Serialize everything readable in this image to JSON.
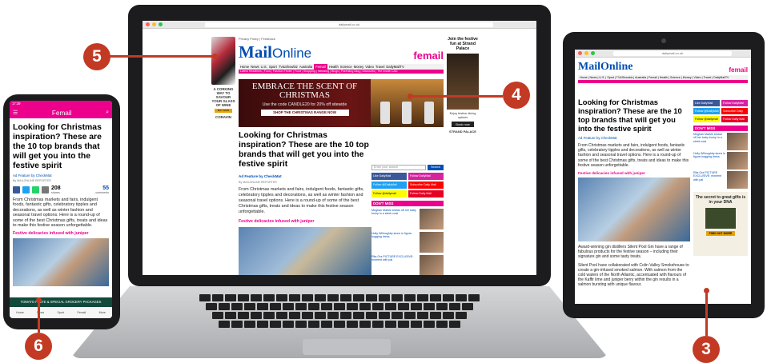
{
  "laptop": {
    "url": "dailymail.co.uk",
    "topline": "Privacy Policy | Feedback",
    "logo_mail": "Mail",
    "logo_online": "Online",
    "femail": "femail",
    "nav": [
      "Home",
      "News",
      "U.S.",
      "Sport",
      "TV&Showbiz",
      "Australia",
      "Femail",
      "Health",
      "Science",
      "Money",
      "Video",
      "Travel",
      "DailyMailTV"
    ],
    "subnav": "Latest Headlines | Food | Fashion Finder | Food | Shopping | Wedding | Blogs | Parenting Blog | Discounts | The Inside CAD",
    "left_ad": {
      "text": "A CORKING WAY TO SAVOUR YOUR GLASS OF WINE",
      "button": "BUY NOW",
      "brand": "CORAVIN"
    },
    "banner": {
      "headline": "EMBRACE THE SCENT OF CHRISTMAS",
      "sub": "Use the code CANDLE20 for 20% off sitewide",
      "button": "SHOP THE CHRISTMAS RANGE NOW"
    },
    "headline": "Looking for Christmas inspiration? These are the 10 top brands that will get you into the festive spirit",
    "feature": "Ad Feature by CheckMat",
    "byline": "By MAILONLINE REPORTER",
    "body": "From Christmas markets and fairs, indulgent foods, fantastic gifts, celebratory tipples and decorations, as well as winter fashion and seasonal travel options. Here is a round-up of some of the best Christmas gifts, treats and ideas to make this festive season unforgettable.",
    "subhead": "Festive delicacies infused with juniper",
    "side": {
      "search_placeholder": "Enter your search",
      "search_btn": "Search",
      "social": [
        {
          "label": "Like DailyMail",
          "color": "#3b5998"
        },
        {
          "label": "Follow DailyMail",
          "color": "#d6249f"
        },
        {
          "label": "Follow @DailyMail",
          "color": "#1da1f2"
        },
        {
          "label": "Subscribe Daily Mail",
          "color": "#ff0000"
        },
        {
          "label": "Follow @dailymail",
          "color": "#fffc00"
        },
        {
          "label": "Follow Daily Mail",
          "color": "#e60023"
        }
      ],
      "dont_miss": "DON'T MISS",
      "items": [
        "Meghan Markle shows off her baby bump in a sleek coat",
        "Holly Willoughby stuns in figure-hugging dress",
        "Rita Ora PICTURE EXCLUSIVE: moment with pal",
        "Kelly Ripa gives fans a glimpse of her festive home"
      ]
    },
    "right_ad": {
      "headline": "Join the festive fun at Strand Palace",
      "text": "Enjoy festive dining options",
      "button": "Book now",
      "brand": "STRAND PALACE"
    }
  },
  "phone": {
    "status": "17:39",
    "title": "Femail",
    "headline": "Looking for Christmas inspiration? These are the 10 top brands that will get you into the festive spirit",
    "feature": "Ad Feature by CheckMat",
    "byline": "By MAILONLINE REPORTER",
    "shares": "208",
    "shares_label": "shares",
    "comments": "55",
    "comments_label": "comments",
    "body": "From Christmas markets and fairs, indulgent foods, fantastic gifts, celebratory tipples and decorations, as well as winter fashion and seasonal travel options. Here is a round-up of some of the best Christmas gifts, treats and ideas to make this festive season unforgettable.",
    "subhead": "Festive delicacies infused with juniper",
    "ad": "TOMATO PASTE & SPECIAL GROCERY PACKAGES",
    "nav": [
      "Home",
      "News",
      "Sport",
      "Femail",
      "More"
    ]
  },
  "tablet": {
    "url": "dailymail.co.uk",
    "logo": "MailOnline",
    "femail": "femail",
    "nav": "Home | News | U.S. | Sport | TV&Showbiz | Australia | Femail | Health | Science | Money | Video | Travel | DailyMailTV",
    "headline": "Looking for Christmas inspiration? These are the 10 top brands that will get you into the festive spirit",
    "feature": "Ad Feature by CheckMat",
    "body": "From Christmas markets and fairs, indulgent foods, fantastic gifts, celebratory tipples and decorations, as well as winter fashion and seasonal travel options. Here is a round-up of some of the best Christmas gifts, treats and ideas to make this festive season unforgettable.",
    "subhead": "Festive delicacies infused with juniper",
    "body2": "Award-winning gin distillers Silent Pool Gin have a range of fabulous products for the festive season – including their signature gin and some tasty treats.",
    "body3": "Silent Pool have collaborated with Colin Valley Smokehouse to create a gin-infused smoked salmon. With salmon from the cold waters of the North Atlantic, accentuated with flavours of the Kaffir lime and juniper berry within the gin results in a salmon bursting with unique flavour.",
    "dont_miss": "DON'T MISS",
    "ad": {
      "headline": "The secret to great gifts is in your DNA",
      "button": "FIND OUT MORE"
    }
  },
  "callouts": {
    "c3": "3",
    "c4": "4",
    "c5": "5",
    "c6": "6"
  }
}
